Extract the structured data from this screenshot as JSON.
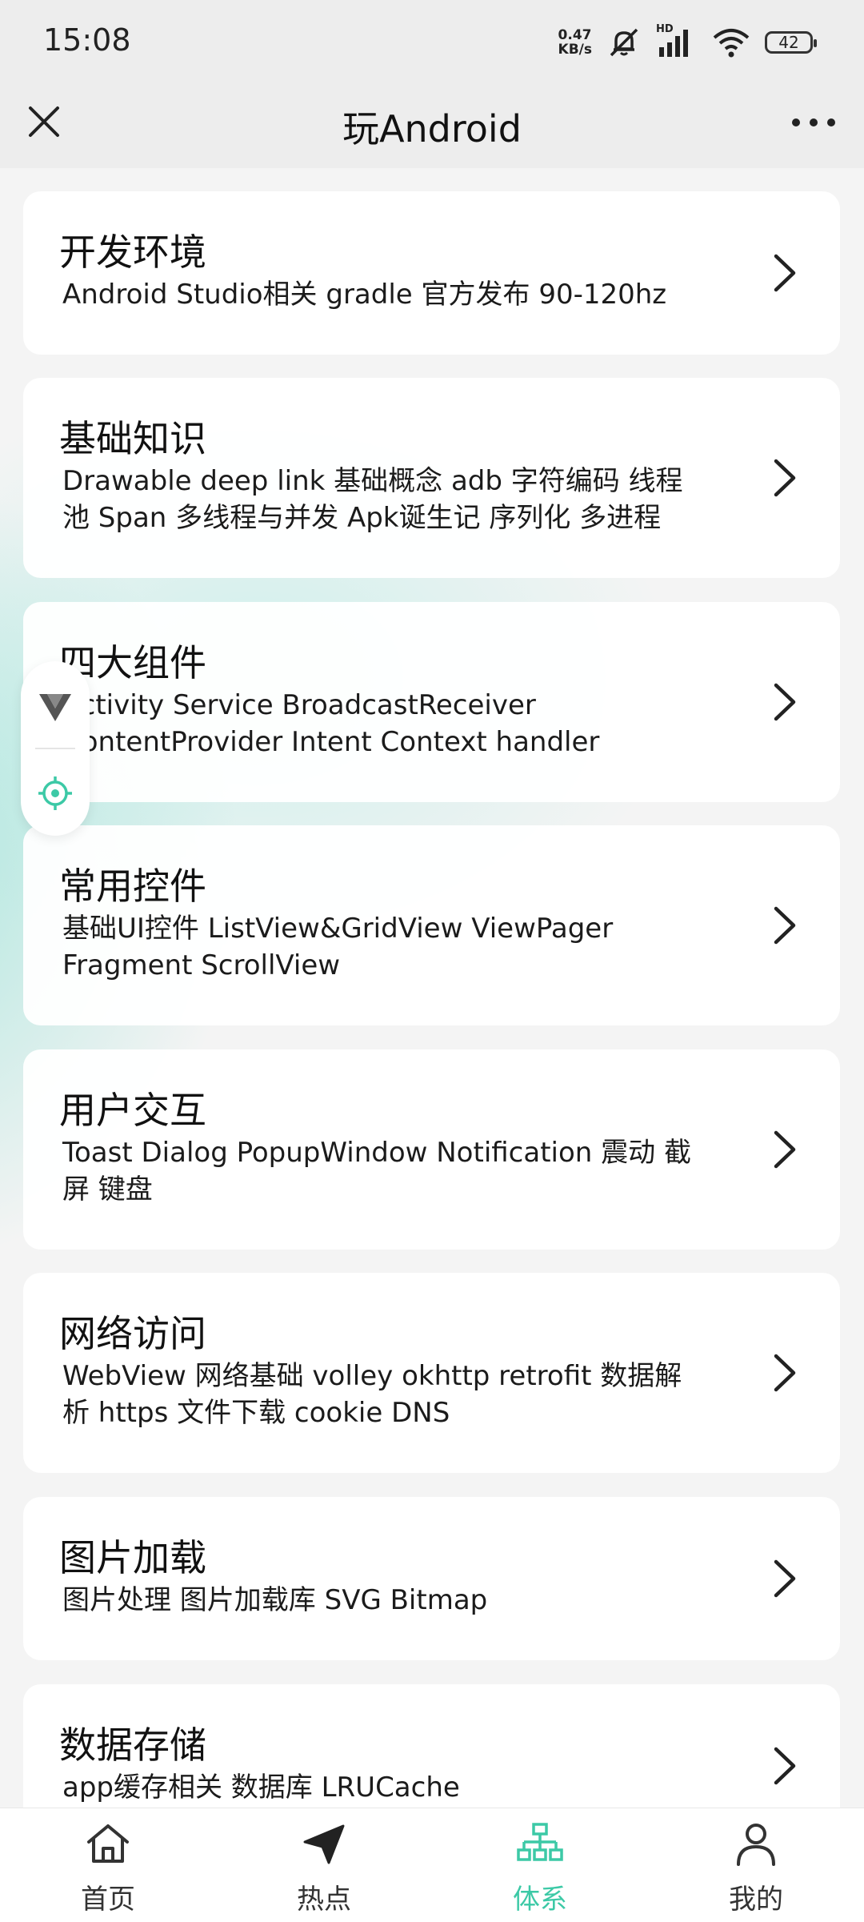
{
  "status": {
    "time": "15:08",
    "net_speed_value": "0.47",
    "net_speed_unit": "KB/s",
    "signal_label": "HD",
    "battery": "42"
  },
  "title_bar": {
    "title": "玩Android",
    "close_icon": "close-icon",
    "more_icon": "more-icon"
  },
  "categories": [
    {
      "title": "开发环境",
      "desc": "Android Studio相关 gradle 官方发布 90-120hz"
    },
    {
      "title": "基础知识",
      "desc": "Drawable deep link 基础概念 adb 字符编码 线程池 Span 多线程与并发 Apk诞生记 序列化 多进程"
    },
    {
      "title": "四大组件",
      "desc": "Activity Service BroadcastReceiver ContentProvider Intent Context handler"
    },
    {
      "title": "常用控件",
      "desc": "基础UI控件 ListView&GridView ViewPager Fragment ScrollView"
    },
    {
      "title": "用户交互",
      "desc": "Toast Dialog PopupWindow Notification 震动 截屏 键盘"
    },
    {
      "title": "网络访问",
      "desc": "WebView 网络基础 volley okhttp retrofit 数据解析 https 文件下载 cookie DNS"
    },
    {
      "title": "图片加载",
      "desc": "图片处理 图片加载库 SVG Bitmap"
    },
    {
      "title": "数据存储",
      "desc": "app缓存相关 数据库 LRUCache"
    }
  ],
  "bottom_nav": [
    {
      "label": "首页",
      "icon": "home-icon",
      "active": false
    },
    {
      "label": "热点",
      "icon": "send-icon",
      "active": false
    },
    {
      "label": "体系",
      "icon": "hierarchy-icon",
      "active": true
    },
    {
      "label": "我的",
      "icon": "person-icon",
      "active": false
    }
  ],
  "colors": {
    "accent": "#3cc9a6",
    "background": "#f2f2f2",
    "card": "#ffffff"
  }
}
